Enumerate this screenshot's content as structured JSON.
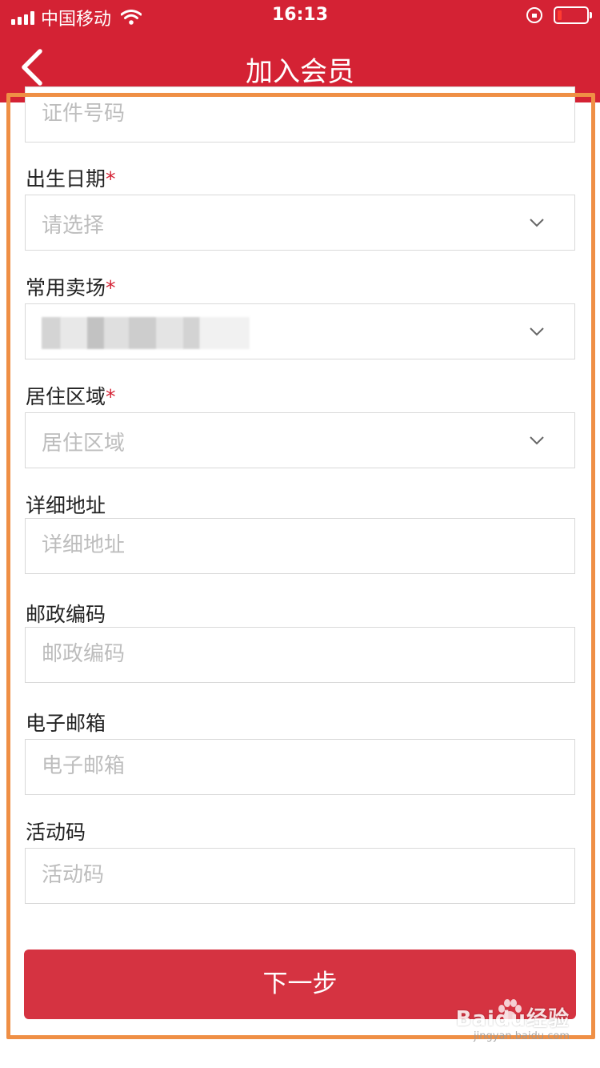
{
  "status_bar": {
    "carrier": "中国移动",
    "time": "16:13"
  },
  "nav": {
    "title": "加入会员"
  },
  "form": {
    "id_number_placeholder": "证件号码",
    "birthdate": {
      "label": "出生日期",
      "required": "*",
      "value": "请选择"
    },
    "store": {
      "label": "常用卖场",
      "required": "*"
    },
    "region": {
      "label": "居住区域",
      "required": "*",
      "value": "居住区域"
    },
    "address": {
      "label": "详细地址",
      "placeholder": "详细地址"
    },
    "postal": {
      "label": "邮政编码",
      "placeholder": "邮政编码"
    },
    "email": {
      "label": "电子邮箱",
      "placeholder": "电子邮箱"
    },
    "activity_code": {
      "label": "活动码",
      "placeholder": "活动码"
    },
    "next_label": "下一步"
  },
  "watermark": {
    "main": "Baidu经验",
    "sub": "jingyan.baidu.com"
  },
  "colors": {
    "brand_red": "#d42234",
    "button_red": "#d53341",
    "highlight_orange": "#ef8f45"
  }
}
